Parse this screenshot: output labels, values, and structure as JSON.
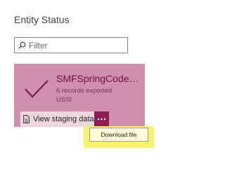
{
  "panel": {
    "title": "Entity Status"
  },
  "filter": {
    "placeholder": "Filter",
    "value": "",
    "icon": "search-icon"
  },
  "entity_tile": {
    "name": "SMFSpringCodesE...",
    "subtitle": "6 records exported",
    "code": "USSI",
    "status_icon": "checkmark-icon",
    "color": "#d18fae",
    "accent": "#8c1d52"
  },
  "actions": {
    "view_staging_label": "View staging data",
    "view_staging_icon": "document-icon",
    "more_icon": "ellipsis-icon",
    "more_label": "···"
  },
  "tooltip": {
    "label": "Download file",
    "highlight": "#f7f46b"
  }
}
